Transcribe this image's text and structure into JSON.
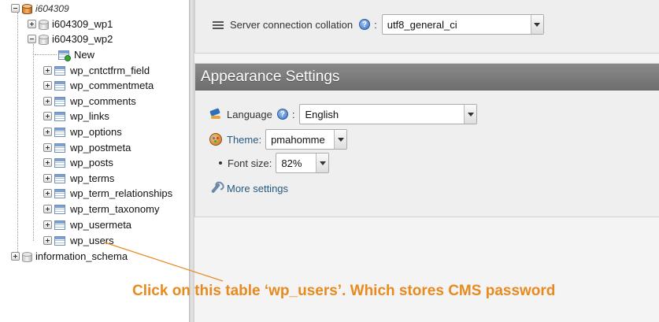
{
  "nav": {
    "root": "i604309",
    "databases": [
      {
        "name": "i604309_wp1",
        "expanded": false
      },
      {
        "name": "i604309_wp2",
        "expanded": true
      },
      {
        "name": "information_schema",
        "expanded": false
      }
    ],
    "new_label": "New",
    "tables": [
      "wp_cntctfrm_field",
      "wp_commentmeta",
      "wp_comments",
      "wp_links",
      "wp_options",
      "wp_postmeta",
      "wp_posts",
      "wp_terms",
      "wp_term_relationships",
      "wp_term_taxonomy",
      "wp_usermeta",
      "wp_users"
    ]
  },
  "server": {
    "collation_label": "Server connection collation",
    "collation_value": "utf8_general_ci"
  },
  "appearance": {
    "title": "Appearance Settings",
    "language_label": "Language",
    "language_value": "English",
    "theme_label": "Theme:",
    "theme_value": "pmahomme",
    "fontsize_label": "Font size:",
    "fontsize_value": "82%",
    "more_settings": "More settings"
  },
  "annotation": {
    "text": "Click on this table ‘wp_users’. Which stores CMS password",
    "color": "#e88a1e"
  },
  "icons": {
    "help": "help-icon",
    "language": "language-icon",
    "theme": "theme-icon",
    "more_settings": "wrench-icon",
    "collation": "list-icon"
  }
}
